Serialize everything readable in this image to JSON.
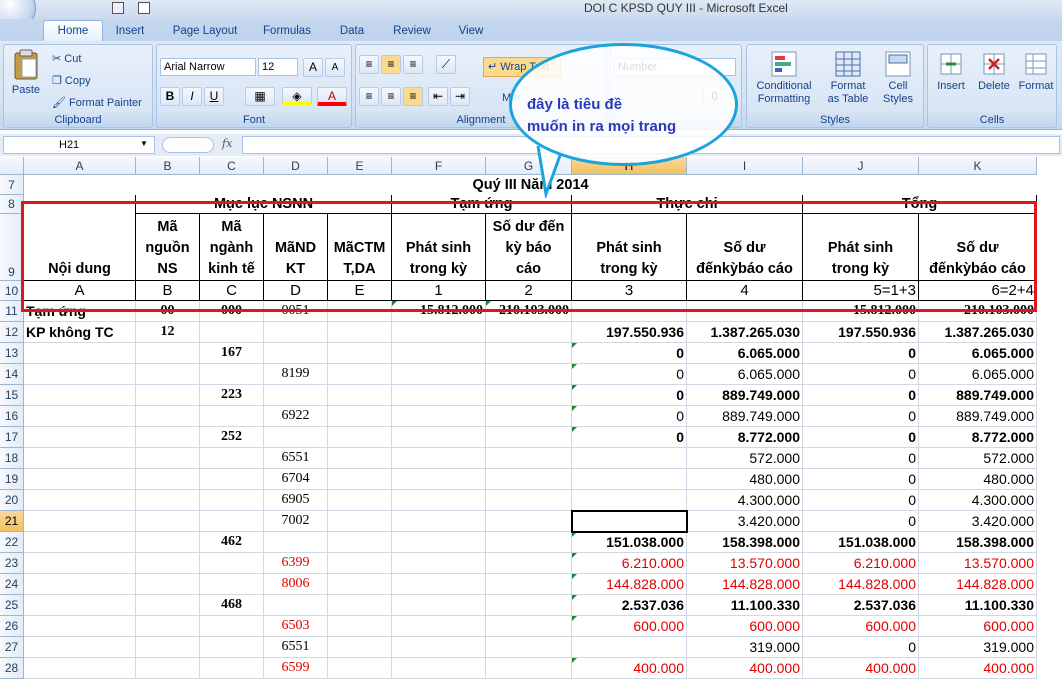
{
  "window": {
    "title": "DOI C KPSD QUY III - Microsoft Excel"
  },
  "ribbon": {
    "tabs": [
      "Home",
      "Insert",
      "Page Layout",
      "Formulas",
      "Data",
      "Review",
      "View"
    ],
    "clipboard": {
      "paste": "Paste",
      "cut": "Cut",
      "copy": "Copy",
      "format_painter": "Format Painter",
      "label": "Clipboard"
    },
    "font": {
      "name": "Arial Narrow",
      "size": "12",
      "label": "Font",
      "bold": "B",
      "italic": "I",
      "underline": "U"
    },
    "alignment": {
      "wrap_text": "Wrap Text",
      "merge": "Mer",
      "label": "Alignment"
    },
    "number": {
      "format": "Number"
    },
    "styles": {
      "conditional": "Conditional",
      "conditional2": "Formatting",
      "as_table": "Format",
      "as_table2": "as Table",
      "cell_styles": "Cell",
      "cell_styles2": "Styles",
      "label": "Styles"
    },
    "cells": {
      "insert": "Insert",
      "delete": "Delete",
      "format": "Format",
      "label": "Cells"
    }
  },
  "formula_bar": {
    "name_box": "H21",
    "fx": "fx",
    "value": ""
  },
  "columns": [
    "A",
    "B",
    "C",
    "D",
    "E",
    "F",
    "G",
    "H",
    "I",
    "J",
    "K"
  ],
  "selected_column": "H",
  "selected_row": "21",
  "sheet": {
    "title_row": {
      "row": "7",
      "text": "Quý III Năm 2014"
    },
    "header": {
      "row8": {
        "muc_luc": "Mục lục NSNN",
        "tam_ung": "Tạm ứng",
        "thuc_chi": "Thực chi",
        "tong": "Tổng"
      },
      "row9": {
        "noi_dung": "Nội dung",
        "ma_nguon": [
          "Mã",
          "nguồn",
          "NS"
        ],
        "ma_nganh": [
          "Mã",
          "ngành",
          "kinh tế"
        ],
        "ma_nd": [
          "MãND",
          "KT"
        ],
        "ma_ctmt": [
          "MãCTM",
          "T,DA"
        ],
        "ps1": [
          "Phát sinh",
          "trong kỳ"
        ],
        "sd1": [
          "Số dư đến",
          "kỳ báo",
          "cáo"
        ],
        "ps2": [
          "Phát sinh",
          "trong kỳ"
        ],
        "sd2": [
          "Số dư",
          "đếnkỳbáo cáo"
        ],
        "ps3": [
          "Phát sinh",
          "trong kỳ"
        ],
        "sd3": [
          "Số dư",
          "đếnkỳbáo cáo"
        ]
      },
      "row10": [
        "A",
        "B",
        "C",
        "D",
        "E",
        "1",
        "2",
        "3",
        "4",
        "5=1+3",
        "6=2+4"
      ]
    },
    "rows": [
      {
        "n": "11",
        "A": "Tạm ứng",
        "B": "00",
        "C": "000",
        "D": "0051",
        "F": "15.812.000",
        "G": "210.103.000",
        "J": "15.812.000",
        "K": "210.103.000"
      },
      {
        "n": "12",
        "A": "KP không TC",
        "B": "12",
        "H": "197.550.936",
        "I": "1.387.265.030",
        "J": "197.550.936",
        "K": "1.387.265.030"
      },
      {
        "n": "13",
        "C": "167",
        "H": "0",
        "I": "6.065.000",
        "J": "0",
        "K": "6.065.000"
      },
      {
        "n": "14",
        "D": "8199",
        "H": "0",
        "I": "6.065.000",
        "J": "0",
        "K": "6.065.000"
      },
      {
        "n": "15",
        "C": "223",
        "H": "0",
        "I": "889.749.000",
        "J": "0",
        "K": "889.749.000"
      },
      {
        "n": "16",
        "D": "6922",
        "H": "0",
        "I": "889.749.000",
        "J": "0",
        "K": "889.749.000"
      },
      {
        "n": "17",
        "C": "252",
        "H": "0",
        "I": "8.772.000",
        "J": "0",
        "K": "8.772.000"
      },
      {
        "n": "18",
        "D": "6551",
        "I": "572.000",
        "J": "0",
        "K": "572.000"
      },
      {
        "n": "19",
        "D": "6704",
        "I": "480.000",
        "J": "0",
        "K": "480.000"
      },
      {
        "n": "20",
        "D": "6905",
        "I": "4.300.000",
        "J": "0",
        "K": "4.300.000"
      },
      {
        "n": "21",
        "D": "7002",
        "I": "3.420.000",
        "J": "0",
        "K": "3.420.000"
      },
      {
        "n": "22",
        "C": "462",
        "H": "151.038.000",
        "I": "158.398.000",
        "J": "151.038.000",
        "K": "158.398.000"
      },
      {
        "n": "23",
        "D": "6399",
        "H": "6.210.000",
        "I": "13.570.000",
        "J": "6.210.000",
        "K": "13.570.000"
      },
      {
        "n": "24",
        "D": "8006",
        "H": "144.828.000",
        "I": "144.828.000",
        "J": "144.828.000",
        "K": "144.828.000"
      },
      {
        "n": "25",
        "C": "468",
        "H": "2.537.036",
        "I": "11.100.330",
        "J": "2.537.036",
        "K": "11.100.330"
      },
      {
        "n": "26",
        "D": "6503",
        "H": "600.000",
        "I": "600.000",
        "J": "600.000",
        "K": "600.000"
      },
      {
        "n": "27",
        "D": "6551",
        "I": "319.000",
        "J": "0",
        "K": "319.000"
      },
      {
        "n": "28",
        "D": "6599",
        "H": "400.000",
        "I": "400.000",
        "J": "400.000",
        "K": "400.000"
      }
    ]
  },
  "callout": {
    "line1": "đây là tiêu đề",
    "line2": "muốn in ra mọi trang"
  },
  "colors": {
    "highlight_box": "#e0161e",
    "callout_border": "#1ba3dc",
    "callout_text": "#2a39b8",
    "red_values": "#e00000"
  }
}
